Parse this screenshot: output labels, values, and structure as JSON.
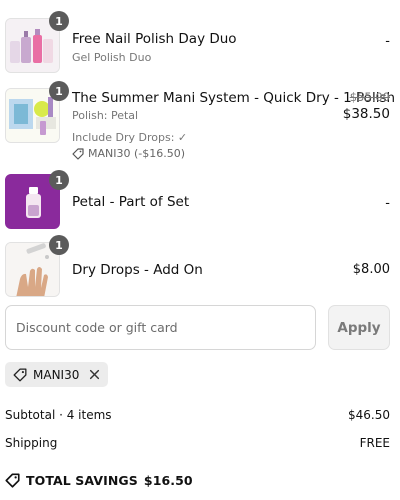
{
  "items": [
    {
      "quantity": "1",
      "name": "Free Nail Polish Day Duo",
      "variant": "Gel Polish Duo",
      "price": "-",
      "thumb_icon": "nail-polish-duo-image"
    },
    {
      "quantity": "1",
      "name": "The Summer Mani System - Quick Dry - 1 Polish",
      "variant": "Polish: Petal",
      "original_price": "$55.00",
      "price": "$38.50",
      "extra": "Include Dry Drops: ✓",
      "discount": "MANI30 (-$16.50)",
      "thumb_icon": "mani-system-kit-image"
    },
    {
      "quantity": "1",
      "name": "Petal - Part of Set",
      "price": "-",
      "thumb_icon": "petal-polish-bottle-image"
    },
    {
      "quantity": "1",
      "name": "Dry Drops - Add On",
      "price": "$8.00",
      "thumb_icon": "dry-drops-hand-image"
    }
  ],
  "discount": {
    "placeholder": "Discount code or gift card",
    "apply_label": "Apply",
    "applied_code": "MANI30"
  },
  "summary": {
    "subtotal_label": "Subtotal · 4 items",
    "subtotal_value": "$46.50",
    "shipping_label": "Shipping",
    "shipping_value": "FREE",
    "savings_label": "TOTAL SAVINGS",
    "savings_value": "$16.50"
  },
  "colors": {
    "badge": "#5b5b5b",
    "petal_purple": "#8a2a9c",
    "apply_bg": "#f3f3f3",
    "chip_bg": "#ececec"
  }
}
